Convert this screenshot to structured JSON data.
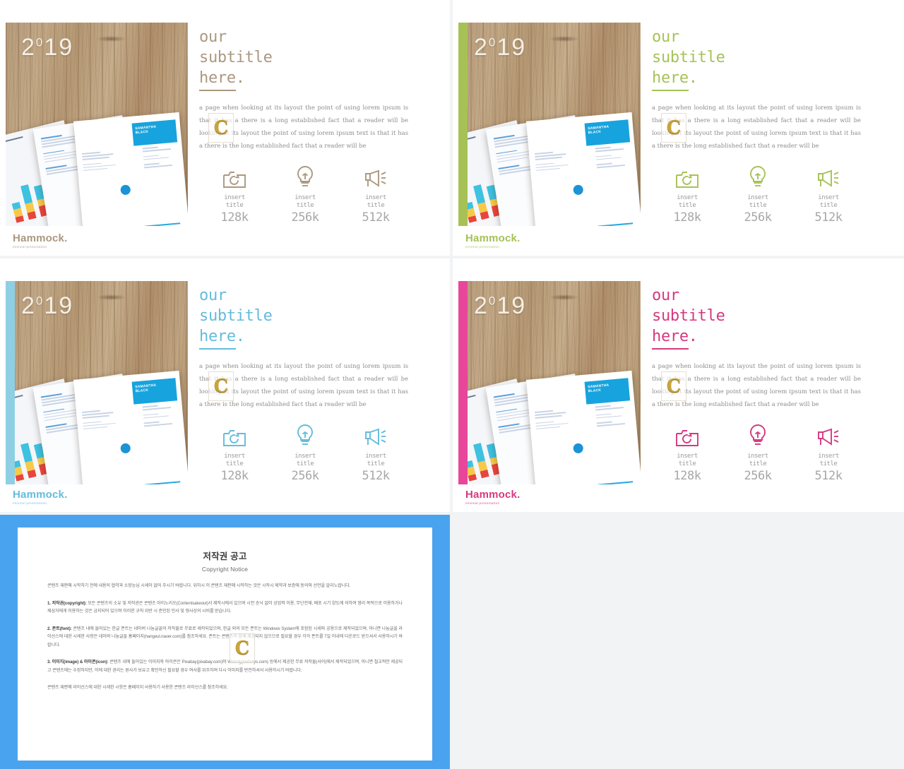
{
  "slides": [
    {
      "id": "slide-beige",
      "accent": "#ab9880",
      "accent_bar": "",
      "year": "2",
      "year_sup": "0",
      "year_rest": "19",
      "headline_l1": "our",
      "headline_l2": "subtitle",
      "headline_l3": "here",
      "headline_dot": ".",
      "body": "a page when looking at its layout the point of using lorem ipsum is that it has a there is a long established fact that a reader will be looking at its layout the point of using lorem ipsum text is that it has a there is the long established fact that a reader will be",
      "stats": [
        {
          "icon": "camera-icon",
          "title": "insert\ntitle",
          "value": "128k"
        },
        {
          "icon": "lightbulb-icon",
          "title": "insert\ntitle",
          "value": "256k"
        },
        {
          "icon": "megaphone-icon",
          "title": "insert\ntitle",
          "value": "512k"
        }
      ],
      "logo_name": "Hammock.",
      "logo_sub": "minimal presentation",
      "watermark": "C"
    },
    {
      "id": "slide-green",
      "accent": "#a6c256",
      "accent_bar": "#a6c256",
      "year": "2",
      "year_sup": "0",
      "year_rest": "19",
      "headline_l1": "our",
      "headline_l2": "subtitle",
      "headline_l3": "here",
      "headline_dot": ".",
      "body": "a page when looking at its layout the point of using lorem ipsum is that it has a there is a long established fact that a reader will be looking at its layout the point of using lorem ipsum text is that it has a there is the long established fact that a reader will be",
      "stats": [
        {
          "icon": "camera-icon",
          "title": "insert\ntitle",
          "value": "128k"
        },
        {
          "icon": "lightbulb-icon",
          "title": "insert\ntitle",
          "value": "256k"
        },
        {
          "icon": "megaphone-icon",
          "title": "insert\ntitle",
          "value": "512k"
        }
      ],
      "logo_name": "Hammock.",
      "logo_sub": "minimal presentation",
      "watermark": "C"
    },
    {
      "id": "slide-blue",
      "accent": "#63bcdc",
      "accent_bar": "#8ecfe4",
      "year": "2",
      "year_sup": "0",
      "year_rest": "19",
      "headline_l1": "our",
      "headline_l2": "subtitle",
      "headline_l3": "here",
      "headline_dot": ".",
      "body": "a page when looking at its layout the point of using lorem ipsum is that it has a there is a long established fact that a reader will be looking at its layout the point of using lorem ipsum text is that it has a there is the long established fact that a reader will be",
      "stats": [
        {
          "icon": "camera-icon",
          "title": "insert\ntitle",
          "value": "128k"
        },
        {
          "icon": "lightbulb-icon",
          "title": "insert\ntitle",
          "value": "256k"
        },
        {
          "icon": "megaphone-icon",
          "title": "insert\ntitle",
          "value": "512k"
        }
      ],
      "logo_name": "Hammock.",
      "logo_sub": "minimal presentation",
      "watermark": "C"
    },
    {
      "id": "slide-pink",
      "accent": "#d6397f",
      "accent_bar": "#e8469a",
      "year": "2",
      "year_sup": "0",
      "year_rest": "19",
      "headline_l1": "our",
      "headline_l2": "subtitle",
      "headline_l3": "here",
      "headline_dot": ".",
      "body": "a page when looking at its layout the point of using lorem ipsum is that it has a there is a long established fact that a reader will be looking at its layout the point of using lorem ipsum text is that it has a there is the long established fact that a reader will be",
      "stats": [
        {
          "icon": "camera-icon",
          "title": "insert\ntitle",
          "value": "128k"
        },
        {
          "icon": "lightbulb-icon",
          "title": "insert\ntitle",
          "value": "256k"
        },
        {
          "icon": "megaphone-icon",
          "title": "insert\ntitle",
          "value": "512k"
        }
      ],
      "logo_name": "Hammock.",
      "logo_sub": "minimal presentation",
      "watermark": "C"
    }
  ],
  "notice": {
    "title_ko": "저작권 공고",
    "title_en": "Copyright Notice",
    "intro": "콘텐츠 재판매 시작하기 전에 내용의 협약과 소장능님 시세이 없어 주시기 바랍니다. 위하시 이 콘텐츠 재판매 시작하는 것은 시작시 제약과 보증에 동의와 선언을 알리노랍니다.",
    "p1_label": "1. 저작권(copyright):",
    "p1": "모든 콘텐츠의 소유 및 저작권은 콘텐츠 아이노리오(Contentsakeout)서 제작시에서 있으며 시전 승낙 없이 상업적 이용, 무단전재, 배포 시기 양도에 의하여 영리 목적으로 이용하거나 제삼자에게 이용하는 것은 금지되어 있으며 이러한 규칙 위반 시 준인된 민사 및 형사상의 시비를 받습니다.",
    "p2_label": "2. 폰트(font):",
    "p2": "콘텐츠 내에 들어있는 한글 폰트는 네이버 나눔글꼴의 저작물로 무료로 제작되었으며, 한글 외의 모든 폰트는 Windows System에 포함된 시세와 공용으로 제작되었으며, 아니면 나눔글꼴 라이선스에 대한 시세한 사항은 네이버 나눔글꼴 홈페이지(hangeul.naver.com)를 참조하세요. 폰트는 콘텐츠의 함께 제공되지 않으므로 필요할 경우 각각 폰트를 7일 이내에 다운로드 받으셔서 사용하시기 바랍니다.",
    "p3_label": "3. 이미지(image) & 아이콘(icon):",
    "p3": "콘텐츠 내에 들어있는 이미지와 아이콘은 Pixabay(pixabay.com)와 Weboly(webolys.com) 등에서 제공한 무료 저작물(사이)에서 제작되었으며, 아니면 철교적만 제공되고 콘텐츠에는 수정하지만, 이에 대한 권리는 원사가 보유고 확인하신 필요할 경우 여사를 위주하여 다시 이미지를 반전하셔서 사용하시기 바랍니다.",
    "outro": "콘텐츠 재판매 라이선스에 대한 시세한 시항은 홈페이지 사용하기 사용한 콘텐츠 라이선스를 참조하세요.",
    "watermark": "C"
  },
  "colors": {
    "page_bg": "#f2f3f5",
    "notice_border": "#4aa3ef",
    "accent_beige": "#ab9880",
    "accent_green": "#a6c256",
    "accent_blue": "#63bcdc",
    "accent_pink": "#d6397f"
  }
}
